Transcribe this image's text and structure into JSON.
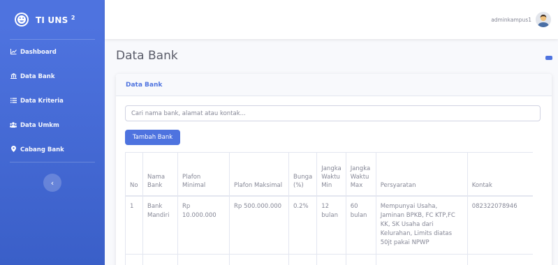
{
  "sidebar": {
    "brand": "TI UNS",
    "brand_sup": "2",
    "items": [
      {
        "label": "Dashboard",
        "icon": "chart-line-icon"
      },
      {
        "label": "Data Bank",
        "icon": "bank-icon"
      },
      {
        "label": "Data Kriteria",
        "icon": "list-icon"
      },
      {
        "label": "Data Umkm",
        "icon": "users-icon"
      },
      {
        "label": "Cabang Bank",
        "icon": "map-marker-icon"
      }
    ],
    "toggle_glyph": "‹"
  },
  "topbar": {
    "username": "adminkampus1"
  },
  "page": {
    "title": "Data Bank"
  },
  "card": {
    "header": "Data Bank",
    "search_placeholder": "Cari nama bank, alamat atau kontak...",
    "add_button": "Tambah Bank"
  },
  "table": {
    "headers": [
      "No",
      "Nama Bank",
      "Plafon Minimal",
      "Plafon Maksimal",
      "Bunga (%)",
      "Jangka Waktu Min",
      "Jangka Waktu Max",
      "Persyaratan",
      "Kontak"
    ],
    "rows": [
      [
        "1",
        "Bank Mandiri",
        "Rp 10.000.000",
        "Rp 500.000.000",
        "0.2%",
        "12 bulan",
        "60 bulan",
        "Mempunyai Usaha, Jaminan BPKB, FC KTP,FC KK, SK Usaha dari Kelurahan, Limits diatas 50jt pakai NPWP",
        "082322078946"
      ]
    ]
  },
  "colors": {
    "primary": "#4e73df",
    "text_muted": "#858796"
  }
}
